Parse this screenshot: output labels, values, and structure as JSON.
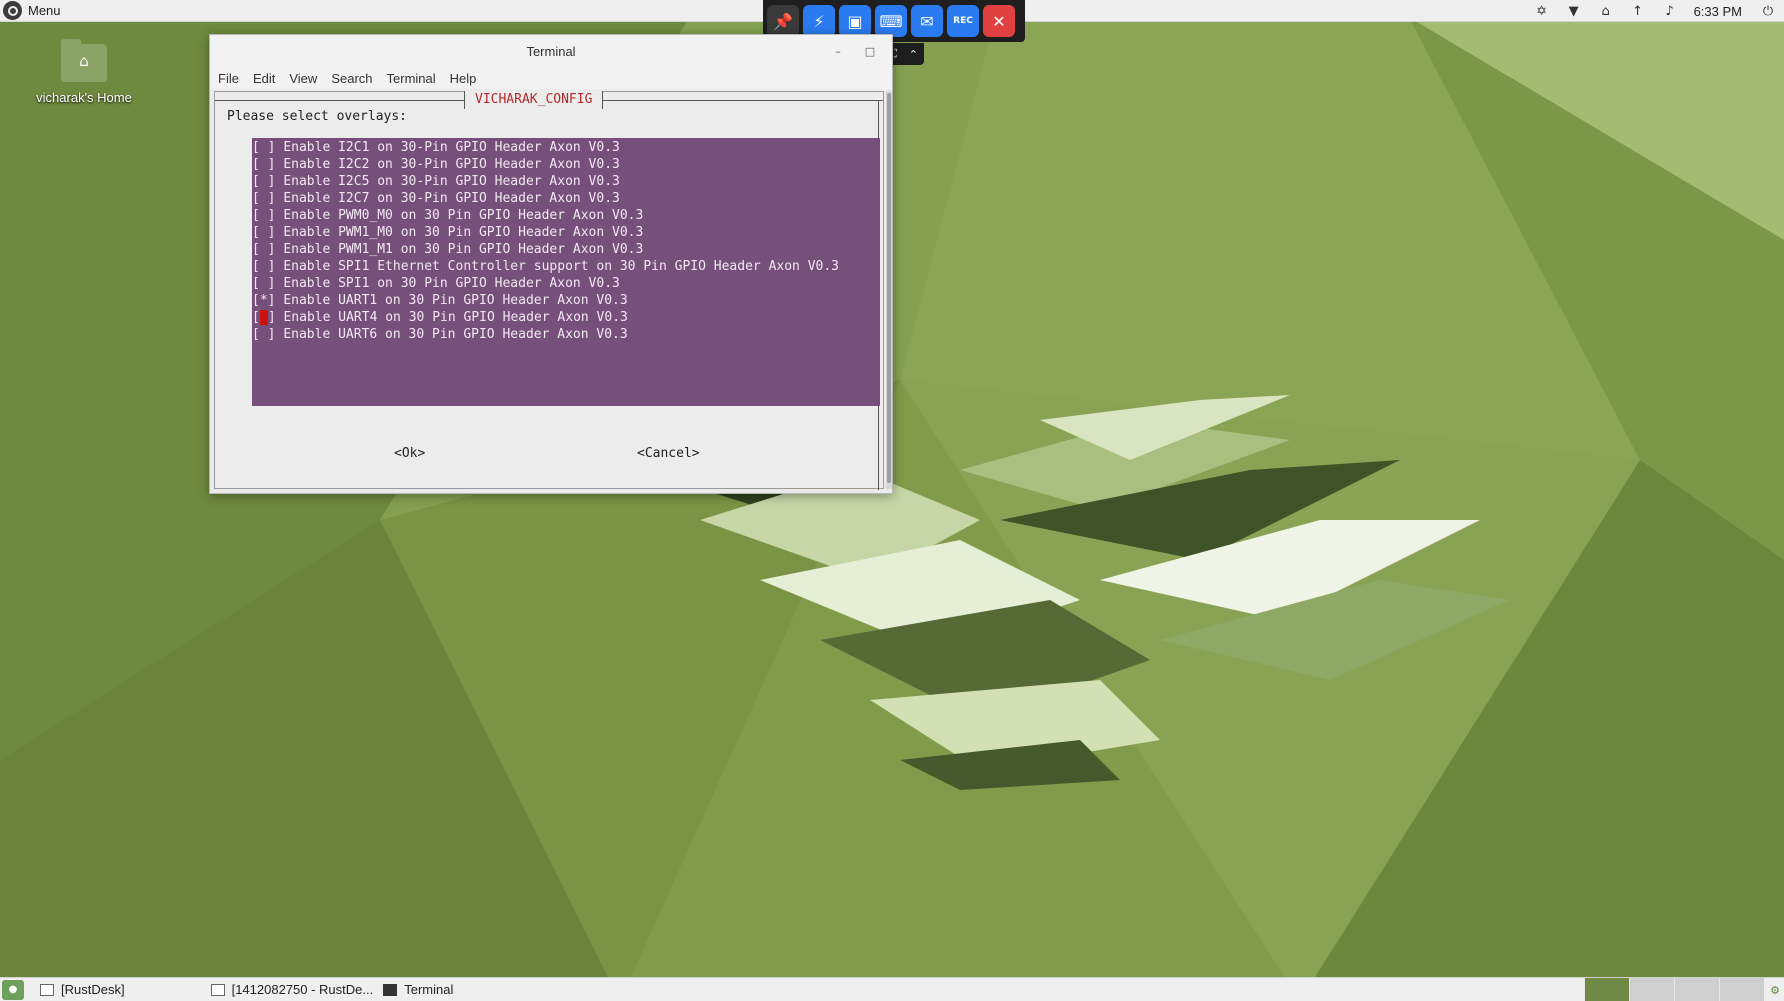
{
  "top_panel": {
    "menu_label": "Menu",
    "clock": "6:33 PM",
    "tray_icons": [
      "bluetooth-icon",
      "wifi-icon",
      "notification-icon",
      "update-icon",
      "volume-icon",
      "power-icon"
    ]
  },
  "remote_toolbar": {
    "buttons": [
      "pin-icon",
      "lightning-icon",
      "monitor-icon",
      "keyboard-icon",
      "chat-icon",
      "record-icon",
      "close-icon"
    ],
    "rec_label": "REC"
  },
  "desktop": {
    "home_icon_label": "vicharak's Home"
  },
  "terminal": {
    "title": "Terminal",
    "menu": [
      "File",
      "Edit",
      "View",
      "Search",
      "Terminal",
      "Help"
    ],
    "dialog_title": "VICHARAK_CONFIG",
    "prompt": "Please select overlays:",
    "options": [
      {
        "mark": "[ ]",
        "label": "Enable I2C1 on 30-Pin GPIO Header Axon V0.3",
        "checked": false
      },
      {
        "mark": "[ ]",
        "label": "Enable I2C2 on 30-Pin GPIO Header Axon V0.3",
        "checked": false
      },
      {
        "mark": "[ ]",
        "label": "Enable I2C5 on 30-Pin GPIO Header Axon V0.3",
        "checked": false
      },
      {
        "mark": "[ ]",
        "label": "Enable I2C7 on 30-Pin GPIO Header Axon V0.3",
        "checked": false
      },
      {
        "mark": "[ ]",
        "label": "Enable PWM0_M0 on 30 Pin GPIO Header Axon V0.3",
        "checked": false
      },
      {
        "mark": "[ ]",
        "label": "Enable PWM1_M0 on 30 Pin GPIO Header Axon V0.3",
        "checked": false
      },
      {
        "mark": "[ ]",
        "label": "Enable PWM1_M1 on 30 Pin GPIO Header Axon V0.3",
        "checked": false
      },
      {
        "mark": "[ ]",
        "label": "Enable SPI1 Ethernet Controller support on 30 Pin GPIO Header Axon V0.3",
        "checked": false
      },
      {
        "mark": "[ ]",
        "label": "Enable SPI1 on 30 Pin GPIO Header Axon V0.3",
        "checked": false
      },
      {
        "mark": "[*]",
        "label": "Enable UART1 on 30 Pin GPIO Header Axon V0.3",
        "checked": true
      },
      {
        "mark": "[ ]",
        "label": "Enable UART4 on 30 Pin GPIO Header Axon V0.3",
        "checked": false,
        "cursor": true
      },
      {
        "mark": "[ ]",
        "label": "Enable UART6 on 30 Pin GPIO Header Axon V0.3",
        "checked": false
      }
    ],
    "ok_label": "<Ok>",
    "cancel_label": "<Cancel>"
  },
  "taskbar": {
    "items": [
      "[RustDesk]",
      "[1412082750 - RustDe...",
      "Terminal"
    ]
  },
  "colors": {
    "list_bg": "#76507a",
    "dialog_title": "#b52a2a",
    "cursor": "#cc1111"
  }
}
